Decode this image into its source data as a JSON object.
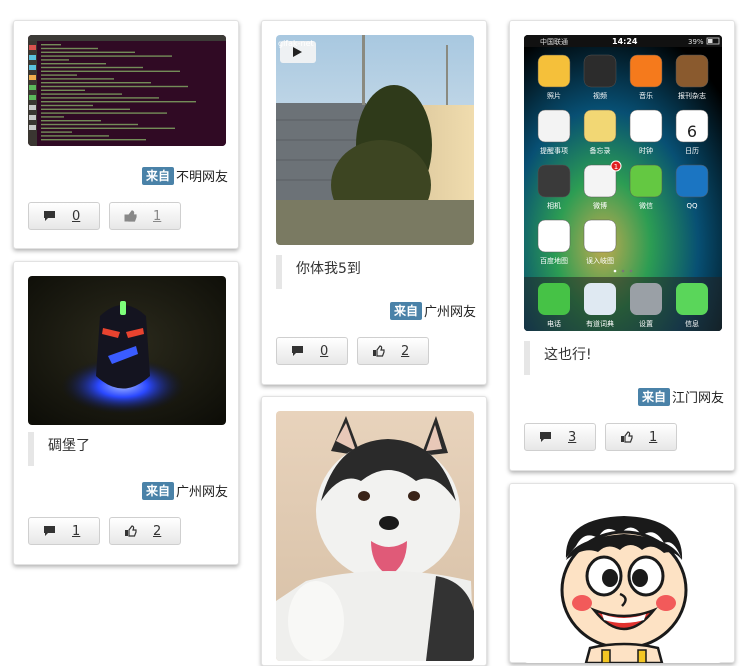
{
  "source_tag": "来自",
  "cards": {
    "c1": {
      "source": "不明网友",
      "comments": "0",
      "likes": "1"
    },
    "c2": {
      "caption": "碉堡了",
      "source": "广州网友",
      "comments": "1",
      "likes": "2"
    },
    "c3": {
      "watermark": "gifak-net",
      "caption": "你体我5到",
      "source": "广州网友",
      "comments": "0",
      "likes": "2"
    },
    "c5": {
      "caption": "这也行!",
      "source": "江门网友",
      "comments": "3",
      "likes": "1",
      "phone": {
        "carrier": "中国联通",
        "time": "14:24",
        "battery": "39%",
        "apps": [
          "照片",
          "视频",
          "音乐",
          "报刊杂志",
          "提醒事项",
          "备忘录",
          "时钟",
          "日历",
          "相机",
          "微博",
          "微信",
          "QQ",
          "百度地图",
          "误入岐图"
        ],
        "calendar_day": "6",
        "weibo_badge": "1",
        "dock": [
          "电话",
          "有道词典",
          "设置",
          "信息"
        ]
      }
    }
  },
  "colors": {
    "tag_bg": "#4a82a8",
    "card_border": "#e2e2e2"
  }
}
